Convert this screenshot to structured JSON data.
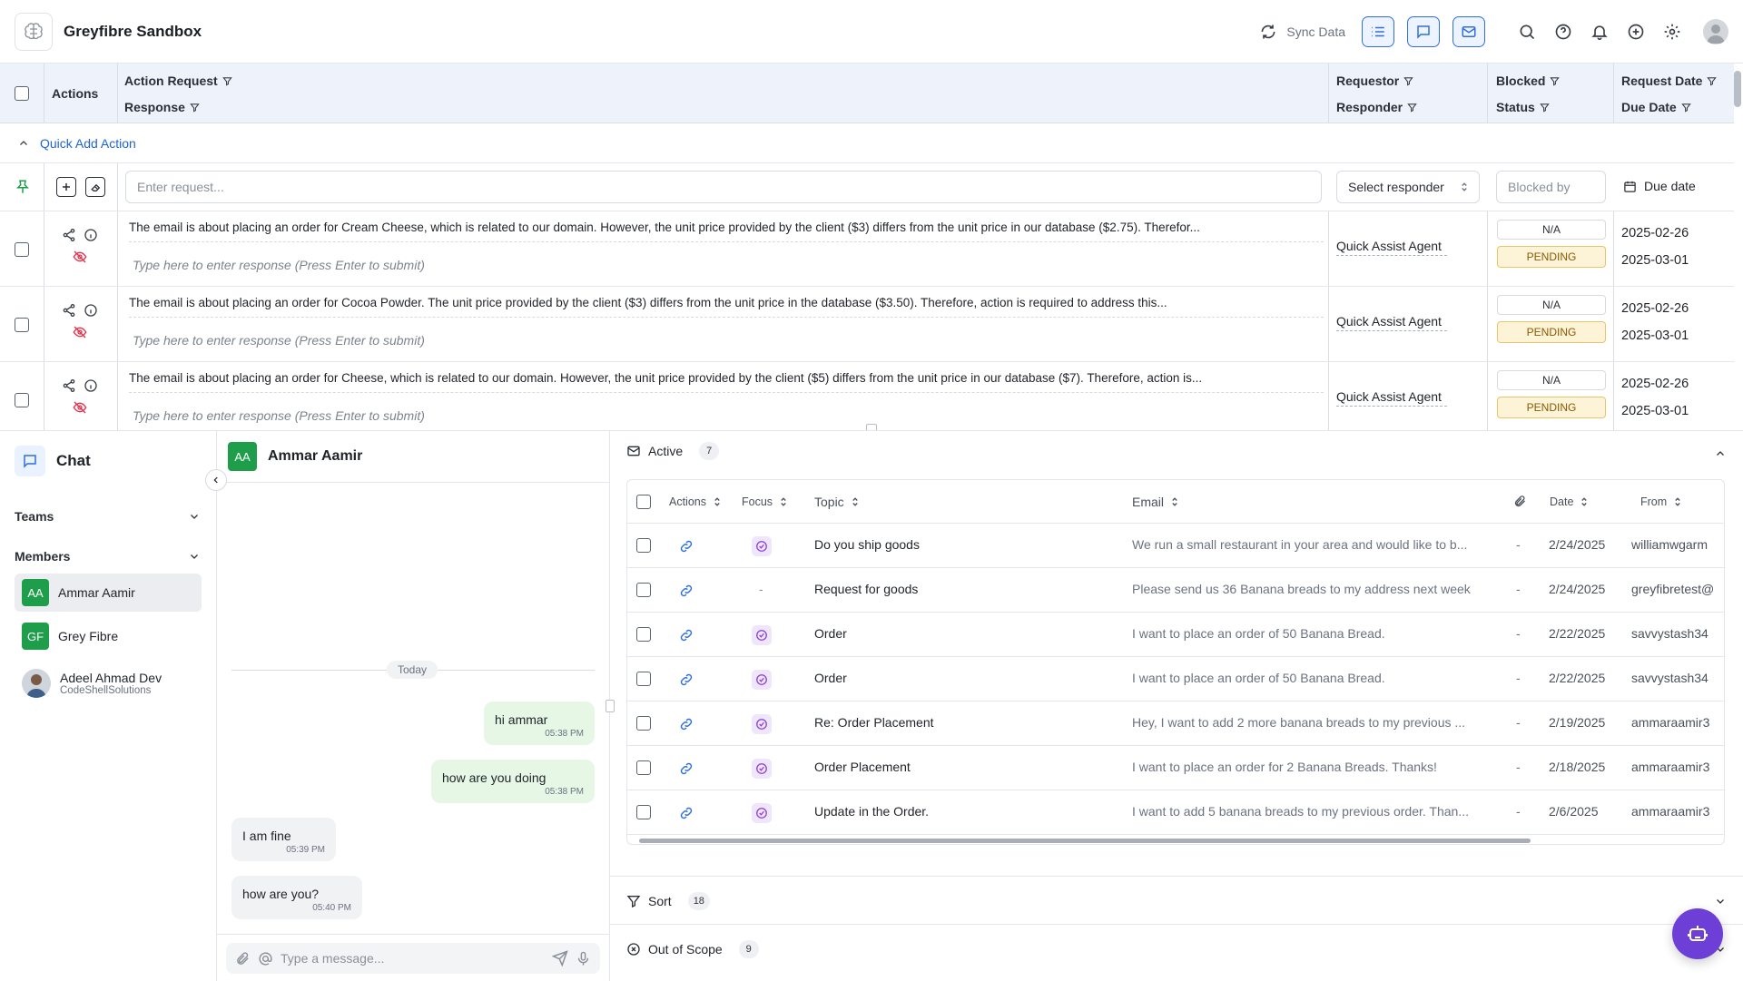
{
  "app": {
    "title": "Greyfibre Sandbox",
    "sync_label": "Sync Data"
  },
  "action_table": {
    "headers": {
      "actions": "Actions",
      "action_request": "Action Request",
      "response": "Response",
      "requestor": "Requestor",
      "responder": "Responder",
      "blocked": "Blocked",
      "status": "Status",
      "request_date": "Request Date",
      "due_date": "Due Date"
    },
    "quick_add": {
      "label": "Quick Add Action",
      "request_placeholder": "Enter request...",
      "responder_select": "Select responder",
      "blocked_placeholder": "Blocked by",
      "due_date_label": "Due date"
    },
    "rows": [
      {
        "request": "The email is about placing an order for Cream Cheese, which is related to our domain. However, the unit price provided by the client ($3) differs from the unit price in our database ($2.75). Therefor...",
        "response_placeholder": "Type here to enter response (Press Enter to submit)",
        "responder": "Quick Assist Agent",
        "blocked": "N/A",
        "status": "PENDING",
        "request_date": "2025-02-26",
        "due_date": "2025-03-01"
      },
      {
        "request": "The email is about placing an order for Cocoa Powder. The unit price provided by the client ($3) differs from the unit price in the database ($3.50). Therefore, action is required to address this...",
        "response_placeholder": "Type here to enter response (Press Enter to submit)",
        "responder": "Quick Assist Agent",
        "blocked": "N/A",
        "status": "PENDING",
        "request_date": "2025-02-26",
        "due_date": "2025-03-01"
      },
      {
        "request": "The email is about placing an order for Cheese, which is related to our domain. However, the unit price provided by the client ($5) differs from the unit price in our database ($7). Therefore, action is...",
        "response_placeholder": "Type here to enter response (Press Enter to submit)",
        "responder": "Quick Assist Agent",
        "blocked": "N/A",
        "status": "PENDING",
        "request_date": "2025-02-26",
        "due_date": "2025-03-01"
      }
    ]
  },
  "sidebar": {
    "title": "Chat",
    "teams_label": "Teams",
    "members_label": "Members",
    "members": [
      {
        "initials": "AA",
        "name": "Ammar Aamir",
        "sub": ""
      },
      {
        "initials": "GF",
        "name": "Grey Fibre",
        "sub": ""
      },
      {
        "initials": "",
        "name": "Adeel Ahmad Dev",
        "sub": "CodeShellSolutions"
      }
    ]
  },
  "chat": {
    "contact_initials": "AA",
    "contact_name": "Ammar Aamir",
    "day_divider": "Today",
    "messages": [
      {
        "text": "hi ammar",
        "time": "05:38 PM",
        "mine": true
      },
      {
        "text": "how are you doing",
        "time": "05:38 PM",
        "mine": true
      },
      {
        "text": "I am fine",
        "time": "05:39 PM",
        "mine": false
      },
      {
        "text": "how are you?",
        "time": "05:40 PM",
        "mine": false
      }
    ],
    "input_placeholder": "Type a message..."
  },
  "emails": {
    "active_label": "Active",
    "active_count": "7",
    "columns": {
      "actions": "Actions",
      "focus": "Focus",
      "topic": "Topic",
      "email": "Email",
      "date": "Date",
      "from": "From"
    },
    "rows": [
      {
        "topic": "Do you ship goods",
        "email": "We run a small restaurant in your area and would like to b...",
        "attach": "-",
        "date": "2/24/2025",
        "from": "williamwgarm",
        "focus": true
      },
      {
        "topic": "Request for goods",
        "email": "Please send us 36 Banana breads to my address next week",
        "attach": "-",
        "date": "2/24/2025",
        "from": "greyfibretest@",
        "focus": false,
        "focus_text": "-"
      },
      {
        "topic": "Order",
        "email": "I want to place an order of 50 Banana Bread.",
        "attach": "-",
        "date": "2/22/2025",
        "from": "savvystash34",
        "focus": true
      },
      {
        "topic": "Order",
        "email": "I want to place an order of 50 Banana Bread.",
        "attach": "-",
        "date": "2/22/2025",
        "from": "savvystash34",
        "focus": true
      },
      {
        "topic": "Re: Order Placement",
        "email": "Hey, I want to add 2 more banana breads to my previous ...",
        "attach": "-",
        "date": "2/19/2025",
        "from": "ammaraamir3",
        "focus": true
      },
      {
        "topic": "Order Placement",
        "email": "I want to place an order for 2 Banana Breads. Thanks!",
        "attach": "-",
        "date": "2/18/2025",
        "from": "ammaraamir3",
        "focus": true
      },
      {
        "topic": "Update in the Order.",
        "email": "I want to add 5 banana breads to my previous order. Than...",
        "attach": "-",
        "date": "2/6/2025",
        "from": "ammaraamir3",
        "focus": true
      }
    ],
    "sort_label": "Sort",
    "sort_count": "18",
    "oos_label": "Out of Scope",
    "oos_count": "9"
  },
  "colors": {
    "accent": "#2f6fdc",
    "green": "#1e9e4a",
    "pending_bg": "#fdf3d7",
    "purple_fab": "#6d3fd6"
  }
}
